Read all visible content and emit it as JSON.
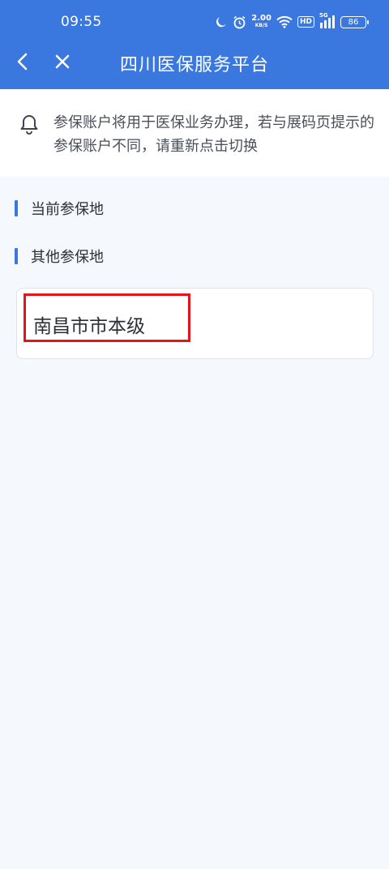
{
  "status_bar": {
    "time": "09:55",
    "speed_value": "2.00",
    "speed_unit": "KB/S",
    "hd_label": "HD",
    "network_label": "5G",
    "battery": "86"
  },
  "nav": {
    "back_icon": "chevron-left-icon",
    "close_icon": "close-icon",
    "title": "四川医保服务平台"
  },
  "notice": {
    "icon": "bell-icon",
    "text": "参保账户将用于医保业务办理，若与展码页提示的参保账户不同，请重新点击切换"
  },
  "sections": {
    "current": {
      "title": "当前参保地"
    },
    "other": {
      "title": "其他参保地",
      "items": [
        {
          "name": "南昌市市本级"
        }
      ]
    }
  },
  "colors": {
    "primary": "#3a78e0",
    "highlight": "#e0161b",
    "background": "#f5f8fc"
  }
}
